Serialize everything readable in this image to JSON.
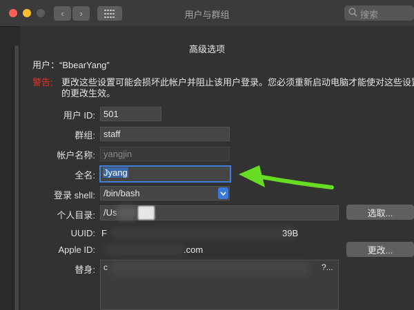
{
  "window": {
    "title": "用户与群组"
  },
  "search": {
    "placeholder": "搜索"
  },
  "sheet": {
    "title": "高级选项",
    "user_line": "用户：“BbearYang”",
    "warning_label": "警告:",
    "warning_line1": "更改这些设置可能会损坏此帐户并阻止该用户登录。您必须重新启动电脑才能使对这些设置",
    "warning_line2": "的更改生效。"
  },
  "form": {
    "user_id": {
      "label": "用户 ID:",
      "value": "501"
    },
    "group": {
      "label": "群组:",
      "value": "staff"
    },
    "account_name": {
      "label": "帐户名称:",
      "value": "yangjin"
    },
    "full_name": {
      "label": "全名:",
      "value": "Jyang"
    },
    "login_shell": {
      "label": "登录 shell:",
      "value": "/bin/bash"
    },
    "home_dir": {
      "label": "个人目录:",
      "value": "/Us",
      "button": "选取..."
    },
    "uuid": {
      "label": "UUID:",
      "value_start": "F",
      "value_end": "39B"
    },
    "apple_id": {
      "label": "Apple ID:",
      "value": ".com",
      "button": "更改..."
    },
    "aliases": {
      "label": "替身:",
      "value_start": "c",
      "value_end": "?..."
    }
  },
  "colors": {
    "accent": "#3a79db",
    "warning": "#e0332a",
    "annotation_arrow": "#66dd22"
  }
}
